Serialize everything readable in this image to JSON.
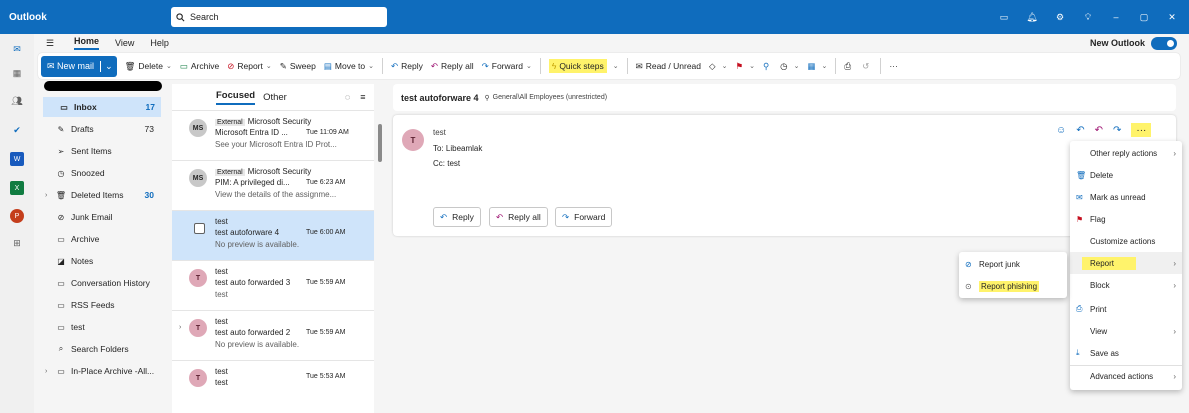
{
  "app": {
    "title": "Outlook"
  },
  "search": {
    "label": "Search"
  },
  "ribbon_tabs": [
    "Home",
    "View",
    "Help"
  ],
  "new_outlook": "New Outlook",
  "ribbon": {
    "new_mail": "New mail",
    "delete": "Delete",
    "archive": "Archive",
    "report": "Report",
    "sweep": "Sweep",
    "move_to": "Move to",
    "reply": "Reply",
    "reply_all": "Reply all",
    "forward": "Forward",
    "quick_steps": "Quick steps",
    "read_unread": "Read / Unread"
  },
  "folders": [
    {
      "label": "Inbox",
      "count": "17"
    },
    {
      "label": "Drafts",
      "count": "73"
    },
    {
      "label": "Sent Items",
      "count": ""
    },
    {
      "label": "Snoozed",
      "count": ""
    },
    {
      "label": "Deleted Items",
      "count": "30"
    },
    {
      "label": "Junk Email",
      "count": ""
    },
    {
      "label": "Archive",
      "count": ""
    },
    {
      "label": "Notes",
      "count": ""
    },
    {
      "label": "Conversation History",
      "count": ""
    },
    {
      "label": "RSS Feeds",
      "count": ""
    },
    {
      "label": "test",
      "count": ""
    },
    {
      "label": "Search Folders",
      "count": ""
    },
    {
      "label": "In-Place Archive -All...",
      "count": ""
    }
  ],
  "message_tabs": {
    "focused": "Focused",
    "other": "Other"
  },
  "messages": [
    {
      "initials": "MS",
      "tag": "External",
      "from": "Microsoft Security",
      "subject": "Microsoft Entra ID ...",
      "time": "Tue 11:09 AM",
      "preview": "See your Microsoft Entra ID Prot..."
    },
    {
      "initials": "MS",
      "tag": "External",
      "from": "Microsoft Security",
      "subject": "PIM: A privileged di...",
      "time": "Tue 6:23 AM",
      "preview": "View the details of the assignme..."
    },
    {
      "initials": "",
      "tag": "",
      "from": "test",
      "subject": "test autoforware 4",
      "time": "Tue 6:00 AM",
      "preview": "No preview is available."
    },
    {
      "initials": "T",
      "tag": "",
      "from": "test",
      "subject": "test auto forwarded 3",
      "time": "Tue 5:59 AM",
      "preview": "test"
    },
    {
      "initials": "T",
      "tag": "",
      "from": "test",
      "subject": "test auto forwarded 2",
      "time": "Tue 5:59 AM",
      "preview": "No preview is available."
    },
    {
      "initials": "T",
      "tag": "",
      "from": "test",
      "subject": "test",
      "time": "Tue 5:53 AM",
      "preview": ""
    }
  ],
  "reading": {
    "subject": "test autoforware 4",
    "path": "General\\All Employees (unrestricted)",
    "sender_initial": "T",
    "sender": "test",
    "to": "To: Libeamlak",
    "cc": "Cc: test",
    "reply": "Reply",
    "reply_all": "Reply all",
    "forward": "Forward"
  },
  "context_menu": {
    "other_reply": "Other reply actions",
    "delete": "Delete",
    "mark_unread": "Mark as unread",
    "flag": "Flag",
    "customize": "Customize actions",
    "report": "Report",
    "block": "Block",
    "print": "Print",
    "view": "View",
    "save_as": "Save as",
    "advanced": "Advanced actions"
  },
  "report_submenu": {
    "junk": "Report junk",
    "phishing": "Report phishing"
  },
  "colors": {
    "brand": "#0f6cbd",
    "highlight": "#fff36b",
    "selected": "#cfe4fa"
  }
}
